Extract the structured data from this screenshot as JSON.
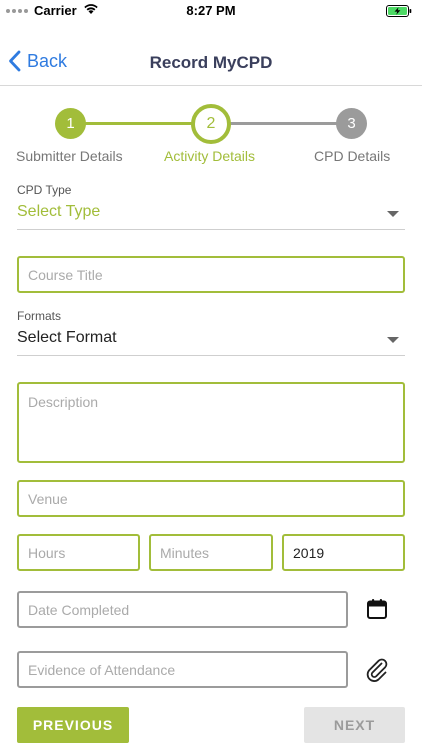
{
  "status_bar": {
    "carrier": "Carrier",
    "time": "8:27 PM"
  },
  "nav": {
    "back_label": "Back",
    "title": "Record MyCPD"
  },
  "stepper": {
    "steps": [
      {
        "number": "1",
        "label": "Submitter Details",
        "state": "done"
      },
      {
        "number": "2",
        "label": "Activity Details",
        "state": "current"
      },
      {
        "number": "3",
        "label": "CPD Details",
        "state": "pending"
      }
    ]
  },
  "form": {
    "cpd_type": {
      "label": "CPD Type",
      "value": "Select Type"
    },
    "course_title": {
      "placeholder": "Course Title"
    },
    "formats": {
      "label": "Formats",
      "value": "Select Format"
    },
    "description": {
      "placeholder": "Description"
    },
    "venue": {
      "placeholder": "Venue"
    },
    "hours": {
      "placeholder": "Hours"
    },
    "minutes": {
      "placeholder": "Minutes"
    },
    "year": {
      "value": "2019"
    },
    "date_completed": {
      "placeholder": "Date Completed"
    },
    "evidence": {
      "placeholder": "Evidence of Attendance"
    }
  },
  "buttons": {
    "previous": "PREVIOUS",
    "next": "NEXT"
  },
  "colors": {
    "accent": "#a2bd3a",
    "link": "#2f7be0",
    "inactive": "#9b9b9b",
    "title": "#3a3f5c"
  },
  "icons": {
    "wifi": "wifi-icon",
    "battery": "battery-charging-icon",
    "back": "chevron-left-icon",
    "calendar": "calendar-icon",
    "attachment": "paperclip-icon"
  }
}
